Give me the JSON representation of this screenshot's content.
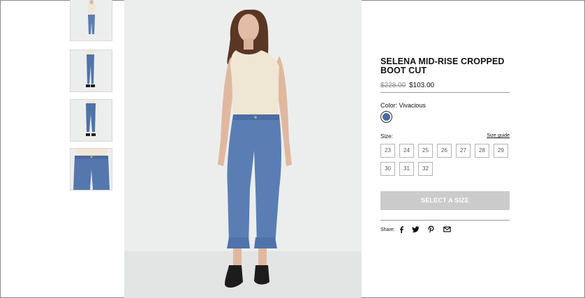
{
  "product": {
    "title": "SELENA MID-RISE CROPPED BOOT CUT",
    "original_price": "$228.00",
    "sale_price": "$103.00",
    "color_label": "Color: Vivacious",
    "swatch_color": "#4c6aa0",
    "size_label": "Size:",
    "size_guide_label": "Size guide",
    "sizes": [
      "23",
      "24",
      "25",
      "26",
      "27",
      "28",
      "29",
      "30",
      "31",
      "32"
    ],
    "cta_label": "SELECT A SIZE",
    "share_label": "Share:"
  },
  "share_icons": [
    "facebook-icon",
    "twitter-icon",
    "pinterest-icon",
    "email-icon"
  ],
  "thumbnails": [
    "front-full-view",
    "side-view",
    "back-view",
    "waist-detail"
  ],
  "colors": {
    "background": "#ffffff",
    "disabled_button": "#cbcbcb",
    "denim": "#4c6aa0",
    "photo_background": "#eceeed"
  }
}
